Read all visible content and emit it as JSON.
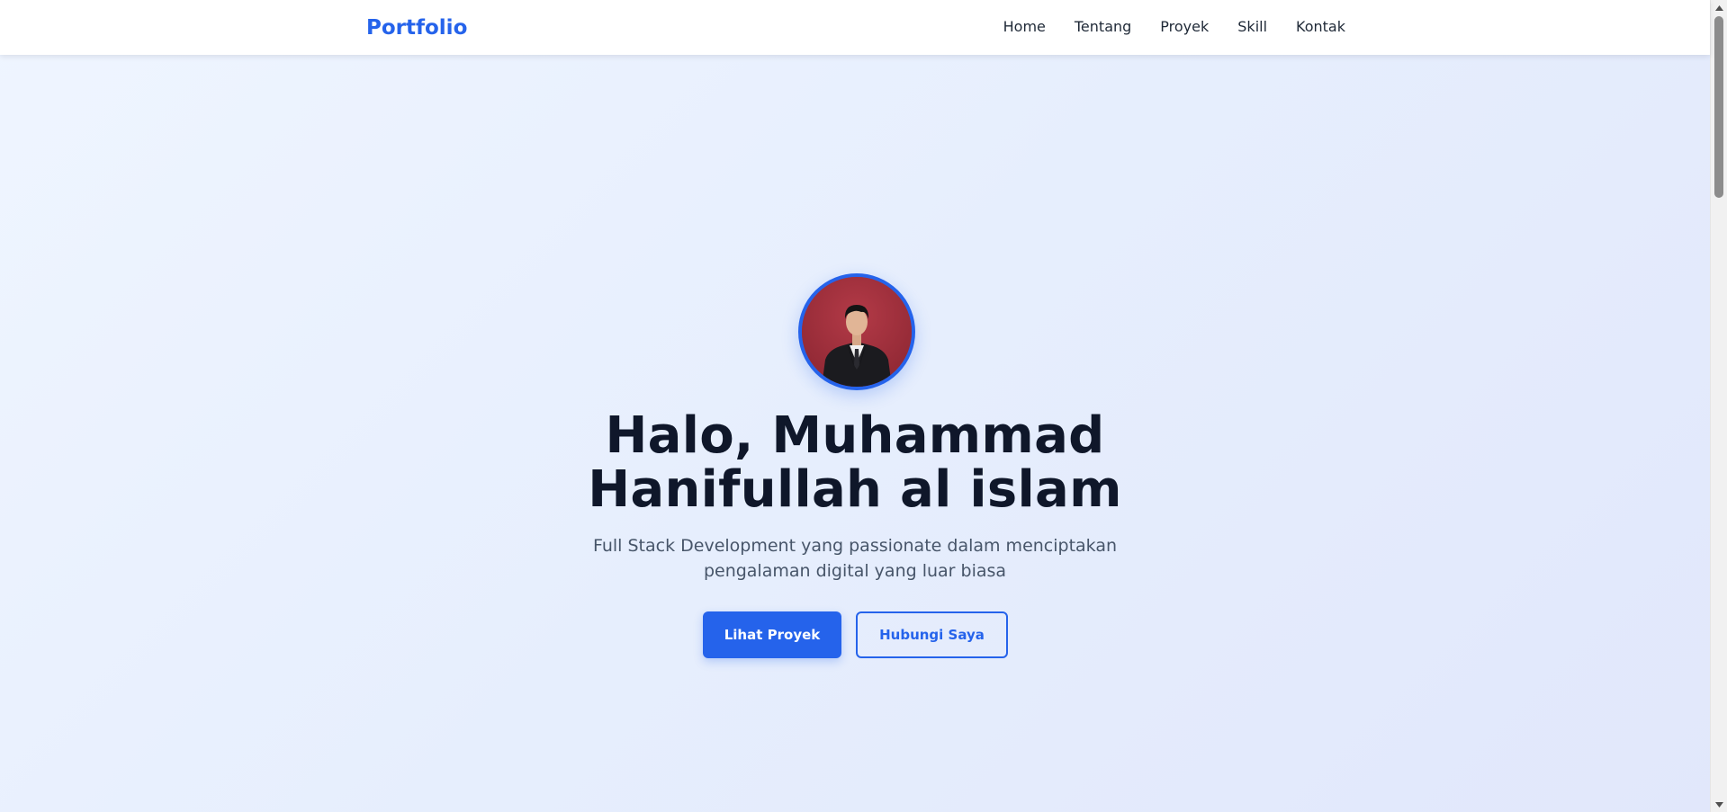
{
  "navbar": {
    "brand": "Portfolio",
    "links": [
      {
        "label": "Home"
      },
      {
        "label": "Tentang"
      },
      {
        "label": "Proyek"
      },
      {
        "label": "Skill"
      },
      {
        "label": "Kontak"
      }
    ]
  },
  "hero": {
    "headline": "Halo, Muhammad Hanifullah al islam",
    "subtitle": "Full Stack Development yang passionate dalam menciptakan pengalaman digital yang luar biasa",
    "primary_button": "Lihat Proyek",
    "secondary_button": "Hubungi Saya"
  },
  "colors": {
    "accent": "#2563eb",
    "heading": "#0f172a",
    "muted_text": "#475569",
    "avatar_background": "#a0313e"
  },
  "icons": {
    "scroll_up": "triangle-up-icon",
    "scroll_down": "triangle-down-icon"
  }
}
